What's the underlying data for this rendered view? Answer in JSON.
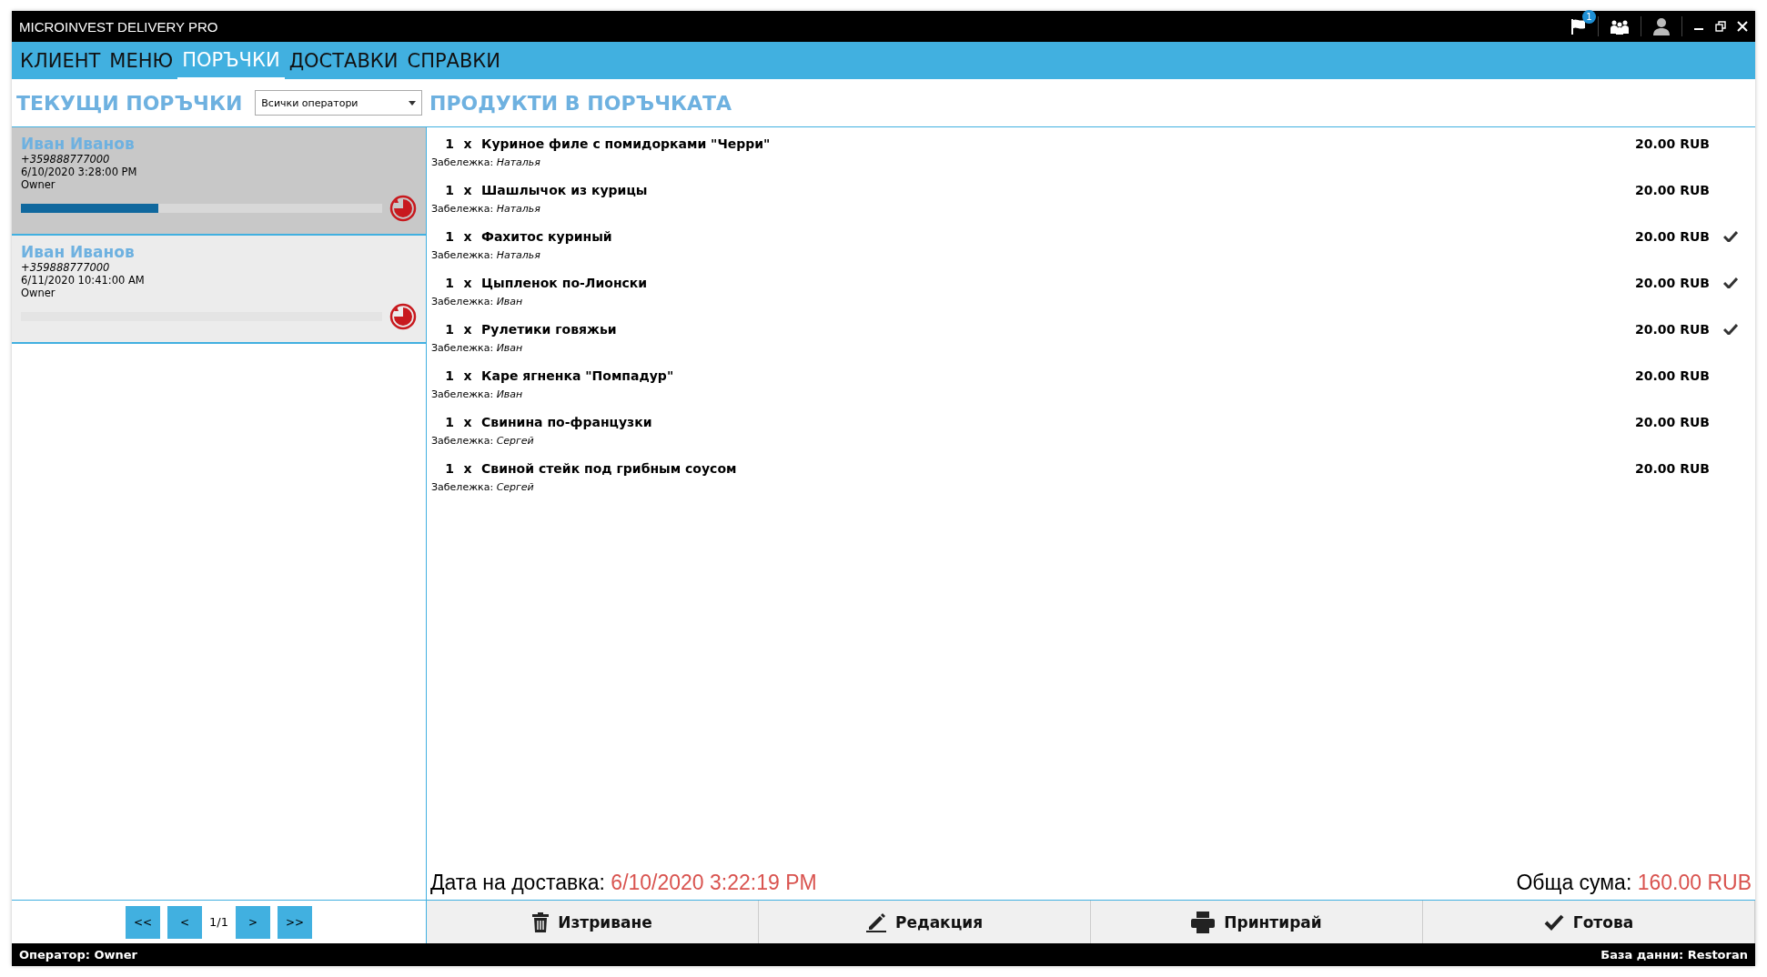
{
  "window": {
    "title": "MICROINVEST DELIVERY PRO",
    "notification_count": "1"
  },
  "menu": [
    {
      "label": "КЛИЕНТ",
      "selected": false
    },
    {
      "label": "МЕНЮ",
      "selected": false
    },
    {
      "label": "ПОРЪЧКИ",
      "selected": true
    },
    {
      "label": "ДОСТАВКИ",
      "selected": false
    },
    {
      "label": "СПРАВКИ",
      "selected": false
    }
  ],
  "orders_panel": {
    "title": "ТЕКУЩИ ПОРЪЧКИ",
    "operator_filter": "Всички оператори",
    "orders": [
      {
        "name": "Иван Иванов",
        "phone": "+359888777000",
        "date": "6/10/2020 3:28:00 PM",
        "operator": "Owner",
        "level": 0.38,
        "selected": true
      },
      {
        "name": "Иван Иванов",
        "phone": "+359888777000",
        "date": "6/11/2020 10:41:00 AM",
        "operator": "Owner",
        "level": 0,
        "selected": false
      }
    ],
    "pager": {
      "first": "<<",
      "prev": "<",
      "page": "1/1",
      "next": ">",
      "last": ">>"
    }
  },
  "products_panel": {
    "title": "ПРОДУКТИ В ПОРЪЧКАТА",
    "products": [
      {
        "qty": "1",
        "x": "x",
        "name": "Куриное филе с помидорками \"Черри\"",
        "note_label": "Забележка:",
        "note": "Наталья",
        "price": "20.00 RUB",
        "checked": false
      },
      {
        "qty": "1",
        "x": "x",
        "name": "Шашлычок из курицы",
        "note_label": "Забележка:",
        "note": "Наталья",
        "price": "20.00 RUB",
        "checked": false
      },
      {
        "qty": "1",
        "x": "x",
        "name": "Фахитос куриный",
        "note_label": "Забележка:",
        "note": "Наталья",
        "price": "20.00 RUB",
        "checked": true
      },
      {
        "qty": "1",
        "x": "x",
        "name": "Цыпленок по-Лионски",
        "note_label": "Забележка:",
        "note": "Иван",
        "price": "20.00 RUB",
        "checked": true
      },
      {
        "qty": "1",
        "x": "x",
        "name": "Рулетики говяжьи",
        "note_label": "Забележка:",
        "note": "Иван",
        "price": "20.00 RUB",
        "checked": true
      },
      {
        "qty": "1",
        "x": "x",
        "name": "Каре ягненка \"Помпадур\"",
        "note_label": "Забележка:",
        "note": "Иван",
        "price": "20.00 RUB",
        "checked": false
      },
      {
        "qty": "1",
        "x": "x",
        "name": "Свинина по-французки",
        "note_label": "Забележка:",
        "note": "Сергей",
        "price": "20.00 RUB",
        "checked": false
      },
      {
        "qty": "1",
        "x": "x",
        "name": "Свиной стейк под грибным соусом",
        "note_label": "Забележка:",
        "note": "Сергей",
        "price": "20.00 RUB",
        "checked": false
      }
    ],
    "delivery_label": "Дата на доставка:",
    "delivery_date": "6/10/2020 3:22:19 PM",
    "total_label": "Обща сума:",
    "total": "160.00 RUB",
    "actions": [
      {
        "kind": "delete",
        "label": "Изтриване"
      },
      {
        "kind": "edit",
        "label": "Редакция"
      },
      {
        "kind": "print",
        "label": "Принтирай"
      },
      {
        "kind": "done",
        "label": "Готова"
      }
    ]
  },
  "status_bar": {
    "operator": "Оператор: Owner",
    "database": "База данни: Restoran"
  }
}
